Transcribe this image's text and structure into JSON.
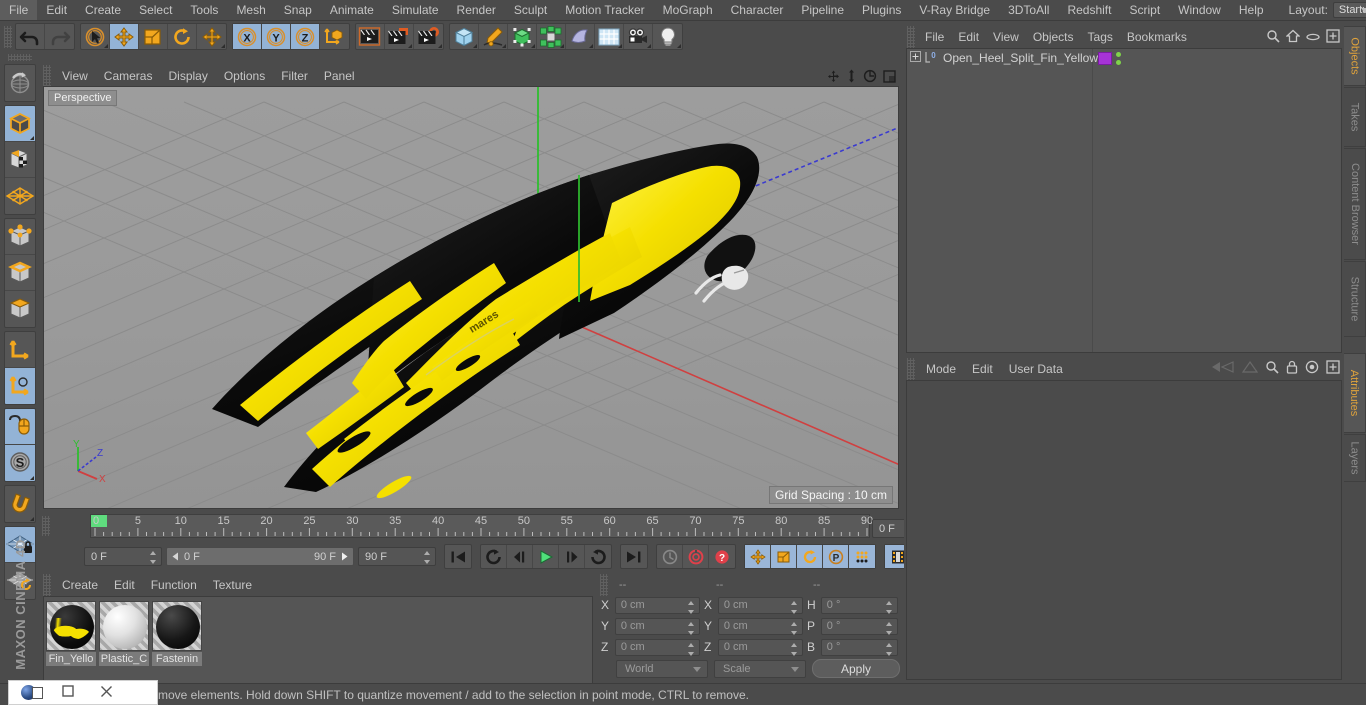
{
  "app": {
    "title": "CINEMA 4D",
    "brand": "MAXON CINEMA 4D"
  },
  "menubar": {
    "items": [
      {
        "label": "File"
      },
      {
        "label": "Edit"
      },
      {
        "label": "Create"
      },
      {
        "label": "Select"
      },
      {
        "label": "Tools"
      },
      {
        "label": "Mesh"
      },
      {
        "label": "Snap"
      },
      {
        "label": "Animate"
      },
      {
        "label": "Simulate"
      },
      {
        "label": "Render"
      },
      {
        "label": "Sculpt"
      },
      {
        "label": "Motion Tracker"
      },
      {
        "label": "MoGraph"
      },
      {
        "label": "Character"
      },
      {
        "label": "Pipeline"
      },
      {
        "label": "Plugins"
      },
      {
        "label": "V-Ray Bridge"
      },
      {
        "label": "3DToAll"
      },
      {
        "label": "Redshift"
      },
      {
        "label": "Script"
      },
      {
        "label": "Window"
      },
      {
        "label": "Help"
      }
    ],
    "layout_label": "Layout:",
    "layout_value": "Startup"
  },
  "toolbar": {
    "groups": [
      {
        "name": "history",
        "buttons": [
          {
            "icon": "undo-icon",
            "active": false
          },
          {
            "icon": "redo-icon",
            "active": false
          }
        ]
      },
      {
        "name": "transform",
        "buttons": [
          {
            "icon": "live-selection-icon",
            "active": false
          },
          {
            "icon": "move-icon",
            "active": true
          },
          {
            "icon": "scale-icon",
            "active": false
          },
          {
            "icon": "rotate-icon",
            "active": false
          },
          {
            "icon": "move-alt-icon",
            "active": false
          }
        ]
      },
      {
        "name": "axis-lock",
        "buttons": [
          {
            "icon": "axis-x-icon",
            "active": true
          },
          {
            "icon": "axis-y-icon",
            "active": true
          },
          {
            "icon": "axis-z-icon",
            "active": true
          },
          {
            "icon": "world-coord-icon",
            "active": false
          }
        ]
      },
      {
        "name": "render",
        "buttons": [
          {
            "icon": "render-view-icon",
            "active": false
          },
          {
            "icon": "render-region-icon",
            "active": false
          },
          {
            "icon": "render-settings-icon",
            "active": false
          }
        ]
      },
      {
        "name": "create",
        "buttons": [
          {
            "icon": "cube-primitive-icon",
            "active": false
          },
          {
            "icon": "spline-pen-icon",
            "active": false
          },
          {
            "icon": "generator-icon",
            "active": false
          },
          {
            "icon": "mograph-cloner-icon",
            "active": false
          },
          {
            "icon": "deformer-icon",
            "active": false
          },
          {
            "icon": "environment-floor-icon",
            "active": false
          },
          {
            "icon": "camera-icon",
            "active": false
          },
          {
            "icon": "light-icon",
            "active": false
          }
        ]
      }
    ]
  },
  "left_toolbar": {
    "groups": [
      {
        "buttons": [
          {
            "icon": "undo-view-icon",
            "active": false
          }
        ]
      },
      {
        "buttons": [
          {
            "icon": "make-editable-icon",
            "active": true
          },
          {
            "icon": "texture-axis-icon",
            "active": false
          },
          {
            "icon": "polygon-mesh-icon",
            "active": false
          }
        ]
      },
      {
        "buttons": [
          {
            "icon": "point-mode-icon",
            "active": false
          },
          {
            "icon": "edge-mode-icon",
            "active": false
          },
          {
            "icon": "polygon-mode-icon",
            "active": false
          }
        ]
      },
      {
        "buttons": [
          {
            "icon": "object-axis-icon",
            "active": false
          },
          {
            "icon": "world-object-axis-icon",
            "active": true
          }
        ]
      },
      {
        "buttons": [
          {
            "icon": "viewport-solo-icon",
            "active": true
          },
          {
            "icon": "snap-settings-icon",
            "active": true
          }
        ]
      },
      {
        "buttons": [
          {
            "icon": "magnet-icon",
            "active": false
          }
        ]
      },
      {
        "buttons": [
          {
            "icon": "workplane-lock-icon",
            "active": true
          },
          {
            "icon": "workplane-rotate-icon",
            "active": false
          }
        ]
      }
    ]
  },
  "viewport": {
    "menu": [
      {
        "label": "View"
      },
      {
        "label": "Cameras"
      },
      {
        "label": "Display"
      },
      {
        "label": "Options"
      },
      {
        "label": "Filter"
      },
      {
        "label": "Panel"
      }
    ],
    "view_label": "Perspective",
    "grid_spacing": "Grid Spacing : 10 cm",
    "axis_gizmo": {
      "x": "X",
      "y": "Y",
      "z": "Z"
    },
    "icons": [
      {
        "icon": "pan-view-icon"
      },
      {
        "icon": "dolly-view-icon"
      },
      {
        "icon": "rotate-view-icon"
      },
      {
        "icon": "maximize-view-icon"
      }
    ],
    "scene_object": "Open Heel Split Fin Yellow",
    "colors": {
      "background": "#9a9a9a",
      "grid_line": "#8a8a8a",
      "fin_yellow": "#f2e312",
      "fin_black": "#0a0a0a",
      "axis_y": "#2fbd2f",
      "axis_x": "#d04040",
      "axis_z": "#3a3ad0"
    }
  },
  "timeline": {
    "ticks": [
      "0",
      "5",
      "10",
      "15",
      "20",
      "25",
      "30",
      "35",
      "40",
      "45",
      "50",
      "55",
      "60",
      "65",
      "70",
      "75",
      "80",
      "85",
      "90"
    ],
    "current_frame": "0 F",
    "range_start": "0 F",
    "range_end": "90 F",
    "max_frame": "90 F",
    "preview_frame": "0 F",
    "transport": [
      {
        "icon": "go-to-start-icon",
        "active": false
      },
      {
        "icon": "play-reverse-loop-icon",
        "active": false
      },
      {
        "icon": "step-back-icon",
        "active": false
      },
      {
        "icon": "play-icon",
        "active": false
      },
      {
        "icon": "step-forward-icon",
        "active": false
      },
      {
        "icon": "loop-icon",
        "active": false
      },
      {
        "icon": "go-to-end-icon",
        "active": false
      }
    ],
    "record_group": [
      {
        "icon": "autokey-icon",
        "active": false
      },
      {
        "icon": "record-active-objects-icon",
        "active": false
      },
      {
        "icon": "keyframe-selection-icon",
        "active": false
      }
    ],
    "key_group": [
      {
        "icon": "key-position-icon",
        "active": true
      },
      {
        "icon": "key-scale-icon",
        "active": true
      },
      {
        "icon": "key-rotation-icon",
        "active": true
      },
      {
        "icon": "key-param-icon",
        "active": true
      },
      {
        "icon": "key-pla-icon",
        "active": true
      }
    ],
    "dope_group": [
      {
        "icon": "timeline-strip-icon",
        "active": true
      }
    ]
  },
  "material_manager": {
    "menu": [
      {
        "label": "Create"
      },
      {
        "label": "Edit"
      },
      {
        "label": "Function"
      },
      {
        "label": "Texture"
      }
    ],
    "materials": [
      {
        "name": "Fin_Yellow",
        "display": "Fin_Yello",
        "type": "textured-yellow-black",
        "selected": true
      },
      {
        "name": "Plastic_Clear",
        "display": "Plastic_C",
        "type": "light-grey",
        "selected": true
      },
      {
        "name": "Fastening",
        "display": "Fastenin",
        "type": "black",
        "selected": true
      }
    ]
  },
  "coordinates": {
    "headers": [
      "--",
      "--",
      "--"
    ],
    "rows": [
      {
        "pos_axis": "X",
        "pos_value": "0 cm",
        "size_axis": "X",
        "size_value": "0 cm",
        "rot_axis": "H",
        "rot_value": "0 °"
      },
      {
        "pos_axis": "Y",
        "pos_value": "0 cm",
        "size_axis": "Y",
        "size_value": "0 cm",
        "rot_axis": "P",
        "rot_value": "0 °"
      },
      {
        "pos_axis": "Z",
        "pos_value": "0 cm",
        "size_axis": "Z",
        "size_value": "0 cm",
        "rot_axis": "B",
        "rot_value": "0 °"
      }
    ],
    "system": "World",
    "mode": "Scale",
    "apply_label": "Apply"
  },
  "object_manager": {
    "menu": [
      {
        "label": "File"
      },
      {
        "label": "Edit"
      },
      {
        "label": "View"
      },
      {
        "label": "Objects"
      },
      {
        "label": "Tags"
      },
      {
        "label": "Bookmarks"
      }
    ],
    "header_icons": [
      {
        "icon": "search-icon"
      },
      {
        "icon": "home-icon"
      },
      {
        "icon": "ellipse-icon"
      },
      {
        "icon": "new-layout-icon"
      }
    ],
    "objects": [
      {
        "name": "Open_Heel_Split_Fin_Yellow",
        "layer_badge": "0",
        "tag_color": "#a633d6",
        "has_expand": true
      }
    ]
  },
  "attributes": {
    "menu": [
      {
        "label": "Mode"
      },
      {
        "label": "Edit"
      },
      {
        "label": "User Data"
      }
    ],
    "header_icons": [
      {
        "icon": "nav-back-icon"
      },
      {
        "icon": "nav-forward-icon"
      },
      {
        "icon": "search-icon"
      },
      {
        "icon": "lock-icon"
      },
      {
        "icon": "target-icon"
      },
      {
        "icon": "new-layout-icon"
      }
    ],
    "content": ""
  },
  "edge_tabs": [
    {
      "label": "Objects",
      "active": true
    },
    {
      "label": "Takes",
      "active": false
    },
    {
      "label": "Content Browser",
      "active": false
    },
    {
      "label": "Structure",
      "active": false
    },
    {
      "label": "Attributes",
      "active": true
    },
    {
      "label": "Layers",
      "active": false
    }
  ],
  "statusbar": {
    "message": "move elements. Hold down SHIFT to quantize movement / add to the selection in point mode, CTRL to remove.",
    "window_controls": [
      {
        "icon": "restore-icon"
      },
      {
        "icon": "maximize-icon"
      },
      {
        "icon": "close-icon"
      }
    ]
  }
}
